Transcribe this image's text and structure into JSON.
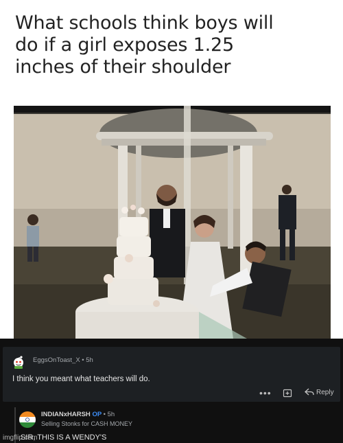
{
  "meme": {
    "caption_line1": "What schools think boys will",
    "caption_line2": "do if a girl exposes 1.25",
    "caption_line3": "inches of their shoulder"
  },
  "comment1": {
    "username": "EggsOnToast_X",
    "separator": "•",
    "time": "5h",
    "text": "I think you meant what teachers will do.",
    "more_label": "•••",
    "reply_label": "Reply"
  },
  "comment2": {
    "username": "INDIANxHARSH",
    "op_badge": "OP",
    "separator": "•",
    "time": "5h",
    "flair": "Selling Stonks for CASH MONEY",
    "text": "SIR, THIS IS A WENDY'S"
  },
  "watermark": "imgflip.com"
}
